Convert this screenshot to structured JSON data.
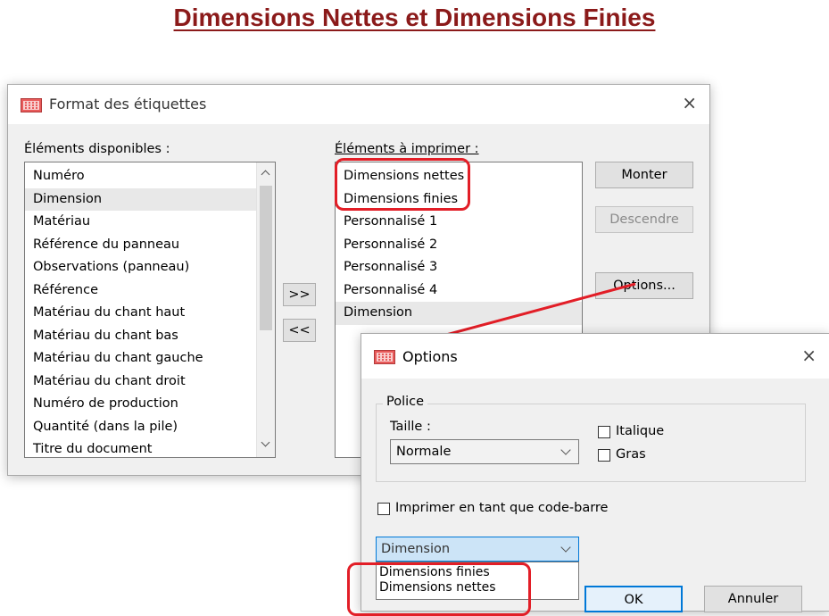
{
  "slide": {
    "title": "Dimensions Nettes et Dimensions Finies"
  },
  "main_dialog": {
    "title": "Format des étiquettes",
    "close_glyph": "×",
    "available_label": "Éléments disponibles :",
    "available_items": [
      "Numéro",
      "Dimension",
      "Matériau",
      "Référence du panneau",
      "Observations (panneau)",
      "Référence",
      "Matériau du chant haut",
      "Matériau du chant bas",
      "Matériau du chant gauche",
      "Matériau du chant droit",
      "Numéro de production",
      "Quantité (dans la pile)",
      "Titre du document"
    ],
    "print_label": "Éléments à imprimer :",
    "print_items": [
      "Dimensions nettes",
      "Dimensions finies",
      "Personnalisé 1",
      "Personnalisé 2",
      "Personnalisé 3",
      "Personnalisé 4",
      "Dimension"
    ],
    "add_button": ">>",
    "remove_button": "<<",
    "up_button": "Monter",
    "down_button": "Descendre",
    "options_button": "Options..."
  },
  "options_dialog": {
    "title": "Options",
    "close_glyph": "×",
    "font_group": "Police",
    "size_label": "Taille :",
    "size_value": "Normale",
    "italic_label": "Italique",
    "bold_label": "Gras",
    "barcode_label": "Imprimer en tant que code-barre",
    "field_value": "Dimension",
    "dropdown_options": [
      "Dimensions finies",
      "Dimensions nettes"
    ],
    "ok_button": "OK",
    "cancel_button": "Annuler"
  },
  "colors": {
    "title": "#8b1a1a",
    "annotation": "#e21e27",
    "accent": "#0078d7"
  }
}
